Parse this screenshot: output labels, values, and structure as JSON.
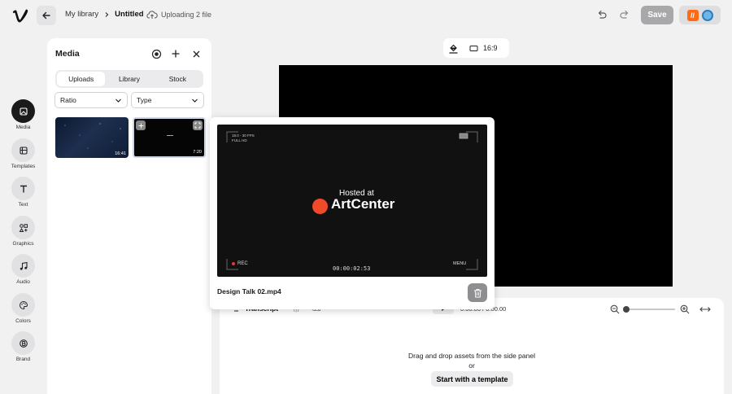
{
  "header": {
    "breadcrumb_library": "My library",
    "project_title": "Untitled",
    "upload_status": "Uploading 2 file",
    "save_label": "Save"
  },
  "rail": {
    "items": [
      {
        "label": "Media",
        "icon": "media-icon"
      },
      {
        "label": "Templates",
        "icon": "templates-icon"
      },
      {
        "label": "Text",
        "icon": "text-icon"
      },
      {
        "label": "Graphics",
        "icon": "graphics-icon"
      },
      {
        "label": "Audio",
        "icon": "audio-icon"
      },
      {
        "label": "Colors",
        "icon": "colors-icon"
      },
      {
        "label": "Brand",
        "icon": "brand-icon"
      }
    ]
  },
  "media_panel": {
    "title": "Media",
    "tabs": [
      "Uploads",
      "Library",
      "Stock"
    ],
    "active_tab": "Uploads",
    "ratio_label": "Ratio",
    "type_label": "Type",
    "thumbnails": [
      {
        "duration": "16:41"
      },
      {
        "duration": "7:20"
      }
    ]
  },
  "canvas": {
    "aspect_ratio": "16:9"
  },
  "preview": {
    "hosted_text": "Hosted at",
    "brand_text": "ArtCenter",
    "rec_label": "REC",
    "timecode": "00:00:02:53",
    "menu_label": "MENU",
    "fps_text": "18.0 - 30 FPS\nFULL HD",
    "file_name": "Design Talk 02.mp4"
  },
  "timeline": {
    "transcript_label": "Transcript",
    "time_display": "0:00.00 / 0:00.00",
    "drop_text": "Drag and drop assets from the side panel",
    "or_text": "or",
    "template_button": "Start with a template"
  },
  "colors": {
    "accent_dark": "#1a1a1a",
    "save_disabled": "#a8a8ab",
    "brand_orange": "#ff6a13",
    "record_red": "#f04a2b"
  }
}
